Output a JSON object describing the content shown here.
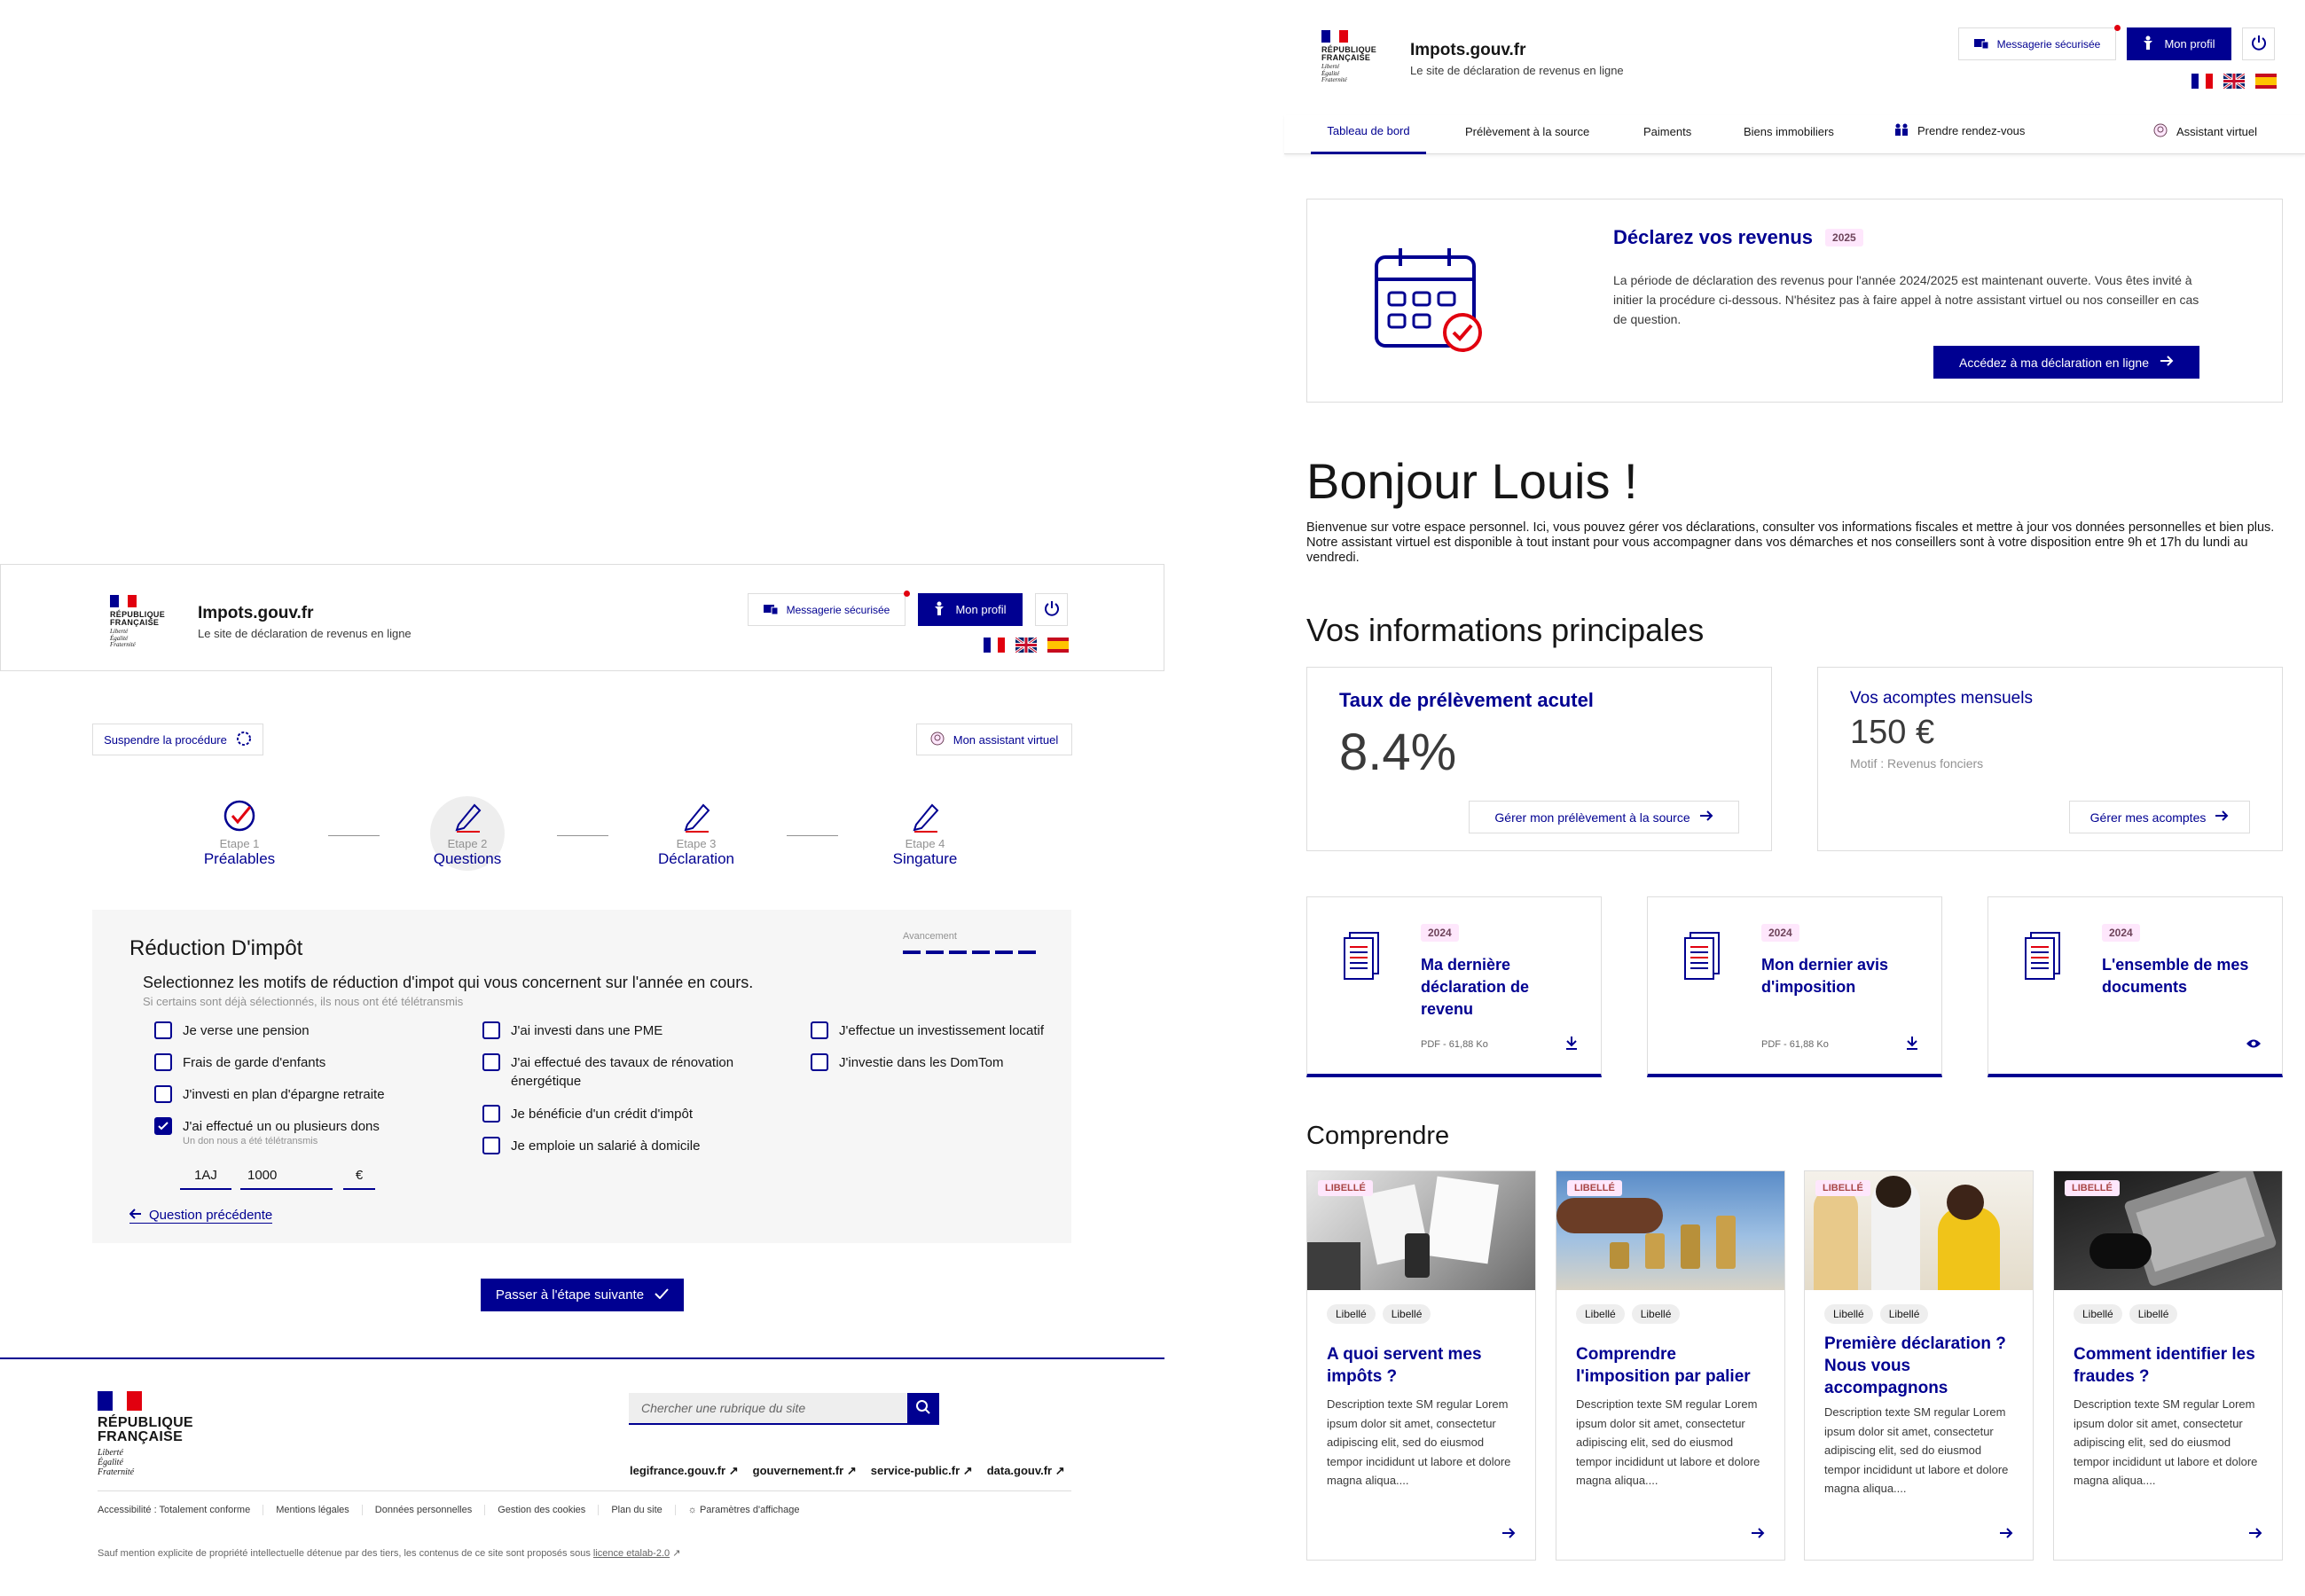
{
  "brand": {
    "republique": "RÉPUBLIQUE",
    "francaise": "FRANÇAISE",
    "devise": [
      "Liberté",
      "Égalité",
      "Fraternité"
    ],
    "site_name": "Impots.gouv.fr",
    "site_tagline": "Le site de déclaration de revenus en ligne"
  },
  "header": {
    "messagerie_label": "Messagerie sécurisée",
    "profil_label": "Mon profil"
  },
  "nav": {
    "items": [
      "Tableau de bord",
      "Prélèvement à la source",
      "Paiments",
      "Biens immobiliers",
      "Prendre rendez-vous"
    ],
    "assistant": "Assistant virtuel"
  },
  "hero": {
    "title": "Déclarez vos revenus",
    "badge": "2025",
    "text": "La période de déclaration des revenus pour l'année 2024/2025 est maintenant ouverte. Vous êtes invité à initier la procédure ci-dessous. N'hésitez pas à faire appel à notre assistant virtuel ou nos conseiller en cas de question.",
    "cta": "Accédez à ma déclaration en ligne"
  },
  "greeting": {
    "title": "Bonjour Louis !",
    "text": "Bienvenue sur votre espace personnel. Ici, vous pouvez gérer vos déclarations, consulter vos informations fiscales et mettre à jour vos données personnelles et bien plus. Notre assistant virtuel est disponible à tout instant pour vous accompagner dans vos démarches et nos conseillers sont à votre disposition entre 9h et 17h du lundi au vendredi."
  },
  "infos": {
    "title": "Vos informations principales",
    "taux": {
      "label": "Taux de prélèvement acutel",
      "value": "8.4%",
      "cta": "Gérer mon prélèvement à la source"
    },
    "acomptes": {
      "label": "Vos acomptes mensuels",
      "value": "150 €",
      "motif": "Motif : Revenus fonciers",
      "cta": "Gérer mes acomptes"
    }
  },
  "documents": [
    {
      "year": "2024",
      "title": "Ma dernière déclaration de revenu",
      "meta": "PDF - 61,88 Ko"
    },
    {
      "year": "2024",
      "title": "Mon dernier avis d'imposition",
      "meta": "PDF - 61,88 Ko"
    },
    {
      "year": "2024",
      "title": "L'ensemble de mes documents",
      "meta": ""
    }
  ],
  "comprendre": {
    "title": "Comprendre",
    "libelle": "LIBELLÉ",
    "tag": "Libellé",
    "articles": [
      {
        "title": "A quoi servent mes impôts ?",
        "desc": "Description texte SM regular Lorem ipsum dolor sit amet, consectetur adipiscing elit, sed do eiusmod tempor incididunt ut labore et dolore magna aliqua...."
      },
      {
        "title": "Comprendre l'imposition par palier",
        "desc": "Description texte SM regular Lorem ipsum dolor sit amet, consectetur adipiscing elit, sed do eiusmod tempor incididunt ut labore et dolore magna aliqua...."
      },
      {
        "title": "Première déclaration ? Nous vous accompagnons",
        "desc": "Description texte SM regular Lorem ipsum dolor sit amet, consectetur adipiscing elit, sed do eiusmod tempor incididunt ut labore et dolore magna aliqua...."
      },
      {
        "title": "Comment identifier les fraudes ?",
        "desc": "Description texte SM regular Lorem ipsum dolor sit amet, consectetur adipiscing elit, sed do eiusmod tempor incididunt ut labore et dolore magna aliqua...."
      }
    ]
  },
  "procedure": {
    "suspend": "Suspendre la procédure",
    "assistant": "Mon assistant virtuel",
    "steps": [
      {
        "num": "Etape 1",
        "name": "Préalables"
      },
      {
        "num": "Etape 2",
        "name": "Questions"
      },
      {
        "num": "Etape 3",
        "name": "Déclaration"
      },
      {
        "num": "Etape 4",
        "name": "Singature"
      }
    ],
    "section_title": "Réduction D'impôt",
    "progress_label": "Avancement",
    "progress_fraction": 1.0,
    "question": "Selectionnez les motifs de réduction d'impot qui vous concernent sur l'année en cours.",
    "hint": "Si certains sont déjà sélectionnés, ils nous ont été télétransmis",
    "options_col1": [
      "Je verse une pension",
      "Frais de garde d'enfants",
      "J'investi en plan d'épargne retraite",
      "J'ai effectué un ou plusieurs dons"
    ],
    "options_col2": [
      "J'ai investi dans une PME",
      "J'ai effectué des tavaux de rénovation énergétique",
      "Je bénéficie d'un crédit d'impôt",
      "Je emploie un salarié à domicile"
    ],
    "options_col3": [
      "J'effectue un investissement locatif",
      "J'investie dans les DomTom"
    ],
    "don_hint": "Un don nous a été télétransmis",
    "case": "1AJ",
    "amount": "1000",
    "currency": "€",
    "back": "Question précédente",
    "next": "Passer à l'étape suivante"
  },
  "footer": {
    "search_placeholder": "Chercher une rubrique du site",
    "links": [
      "legifrance.gouv.fr",
      "gouvernement.fr",
      "service-public.fr",
      "data.gouv.fr"
    ],
    "bottom": [
      "Accessibilité : Totalement conforme",
      "Mentions légales",
      "Données personnelles",
      "Gestion des cookies",
      "Plan du site",
      "Paramètres d'affichage"
    ],
    "license_prefix": "Sauf mention explicite de propriété intellectuelle détenue par des tiers, les contenus de ce site sont proposés sous",
    "license_link": "licence etalab-2.0"
  },
  "colors": {
    "primary": "#000091",
    "accent_red": "#e1000f",
    "badge_bg": "#fee7fc"
  }
}
